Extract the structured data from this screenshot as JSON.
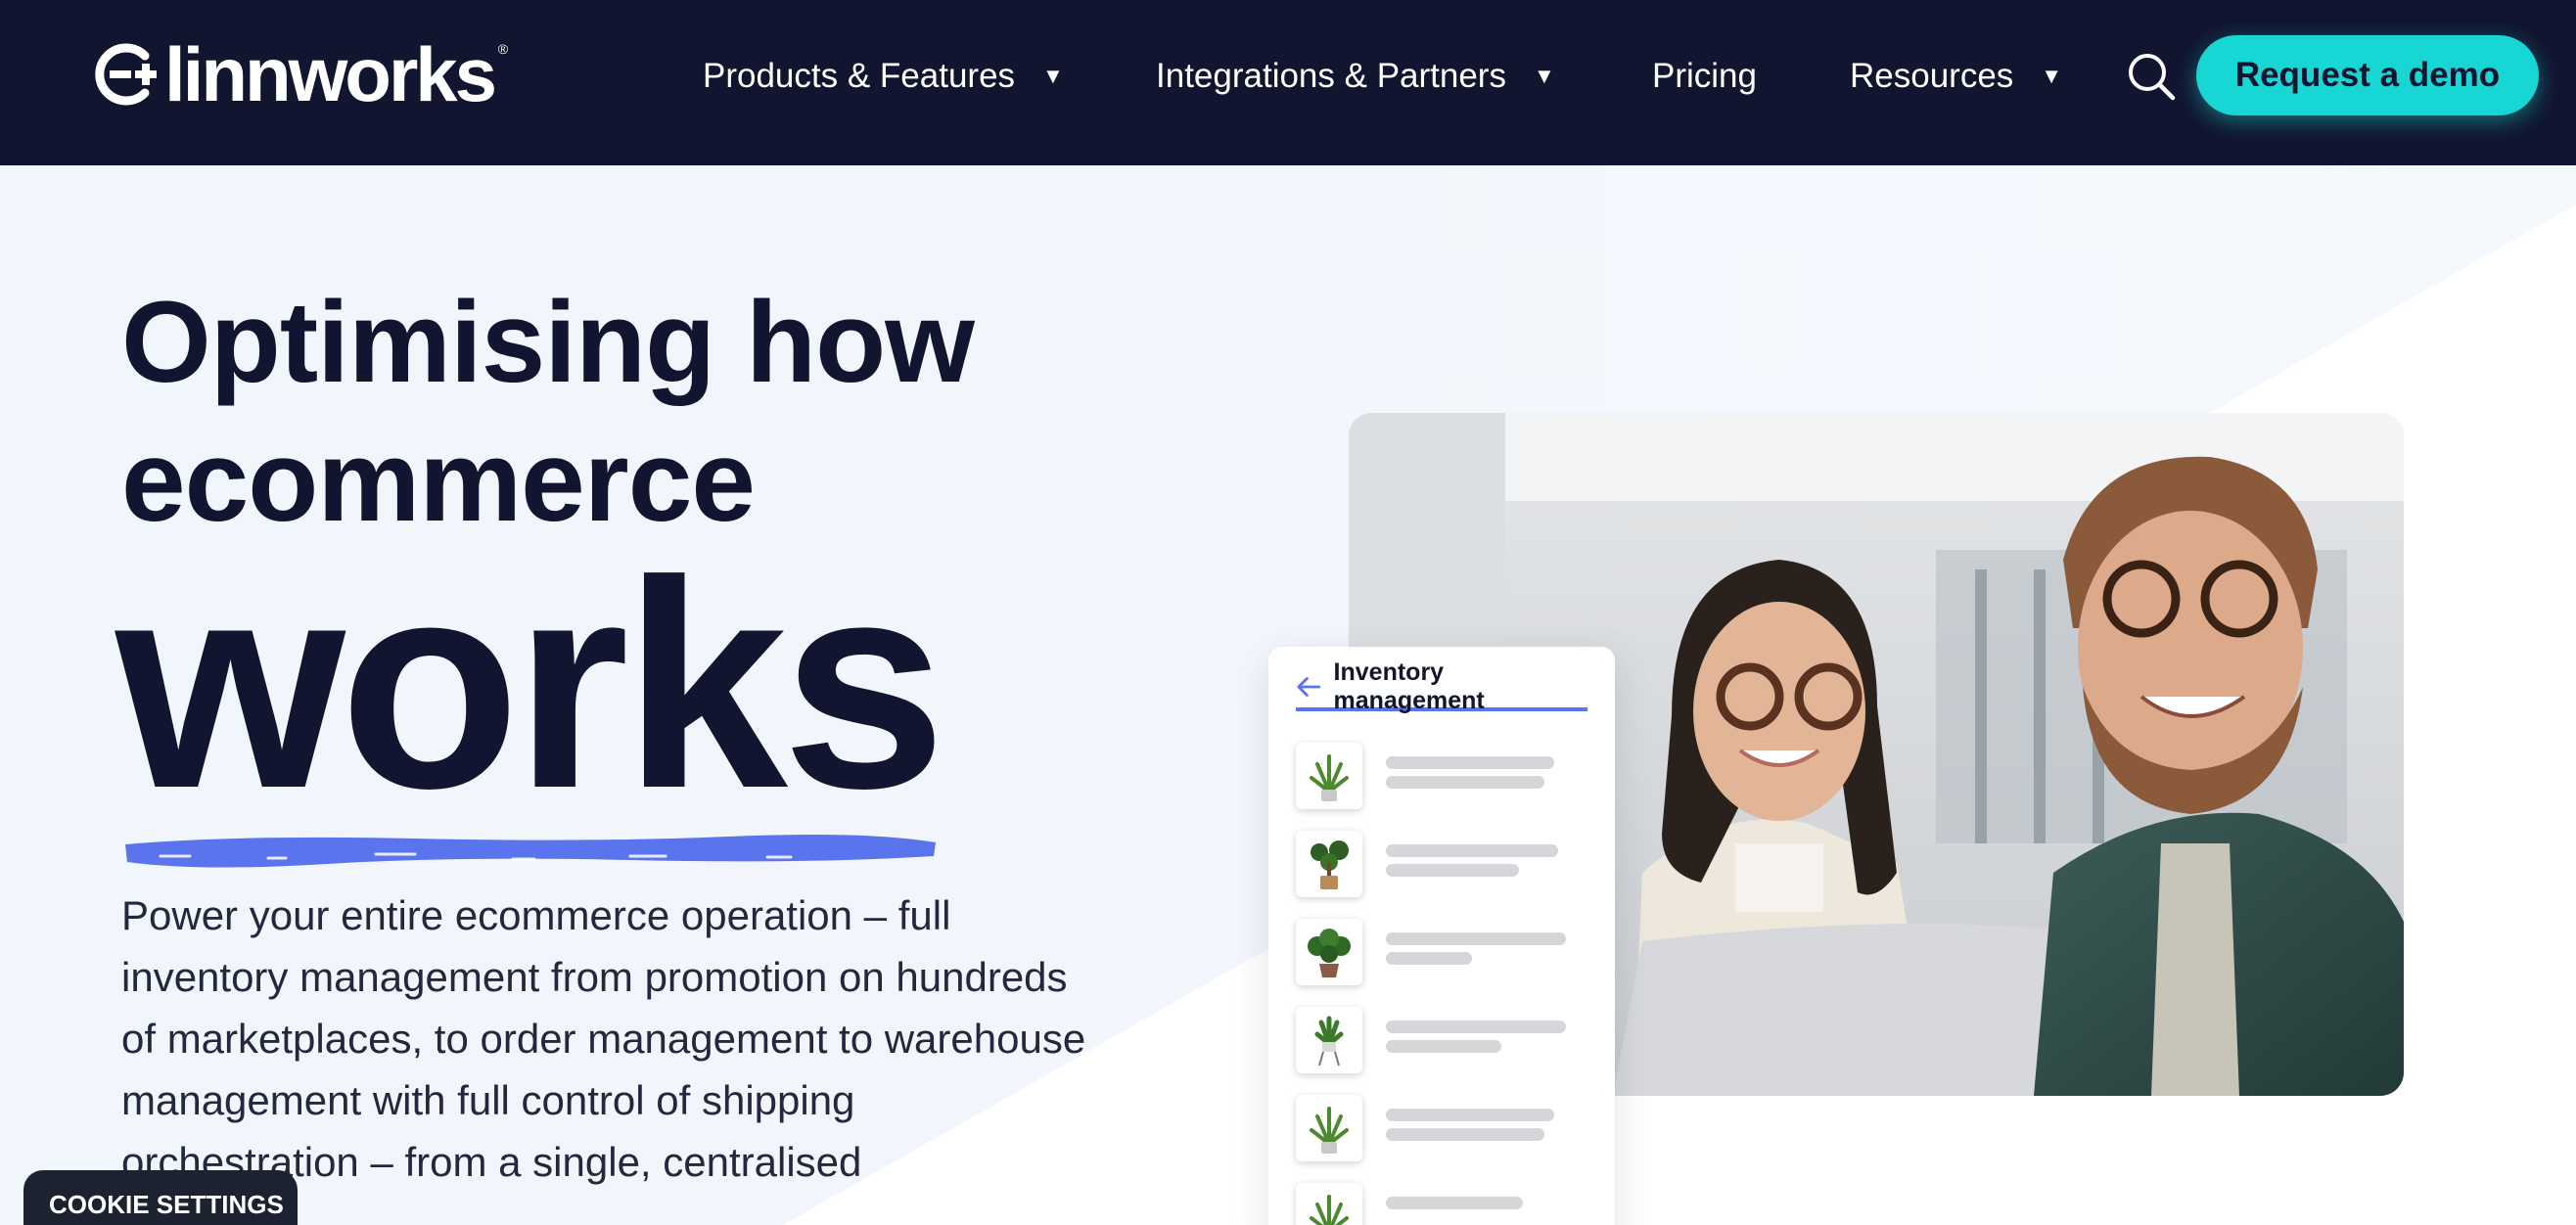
{
  "header": {
    "logo_text": "linnworks",
    "logo_reg": "®",
    "nav": [
      {
        "label": "Products & Features",
        "caret": "▼"
      },
      {
        "label": "Integrations & Partners",
        "caret": "▼"
      },
      {
        "label": "Pricing"
      },
      {
        "label": "Resources",
        "caret": "▼"
      }
    ],
    "search_icon": "search-icon",
    "cta_label": "Request a demo"
  },
  "hero": {
    "headline_line1": "Optimising how",
    "headline_line2": "ecommerce",
    "headline_emphasis": "works",
    "body": "Power your entire ecommerce operation – full inventory management from promotion on hundreds of marketplaces, to order management to warehouse management with full control of shipping orchestration – from a single, centralised"
  },
  "inventory_card": {
    "title": "Inventory management",
    "back_icon": "arrow-left-icon",
    "items": [
      {
        "icon": "plant-icon"
      },
      {
        "icon": "plant-icon"
      },
      {
        "icon": "plant-icon"
      },
      {
        "icon": "plant-icon"
      },
      {
        "icon": "plant-icon"
      },
      {
        "icon": "plant-icon"
      }
    ]
  },
  "cookie": {
    "label": "COOKIE SETTINGS"
  },
  "colors": {
    "header_bg": "#11152f",
    "accent_cyan": "#17d6d3",
    "underline_blue": "#5a74ee",
    "page_bg": "#f3f7fd"
  }
}
